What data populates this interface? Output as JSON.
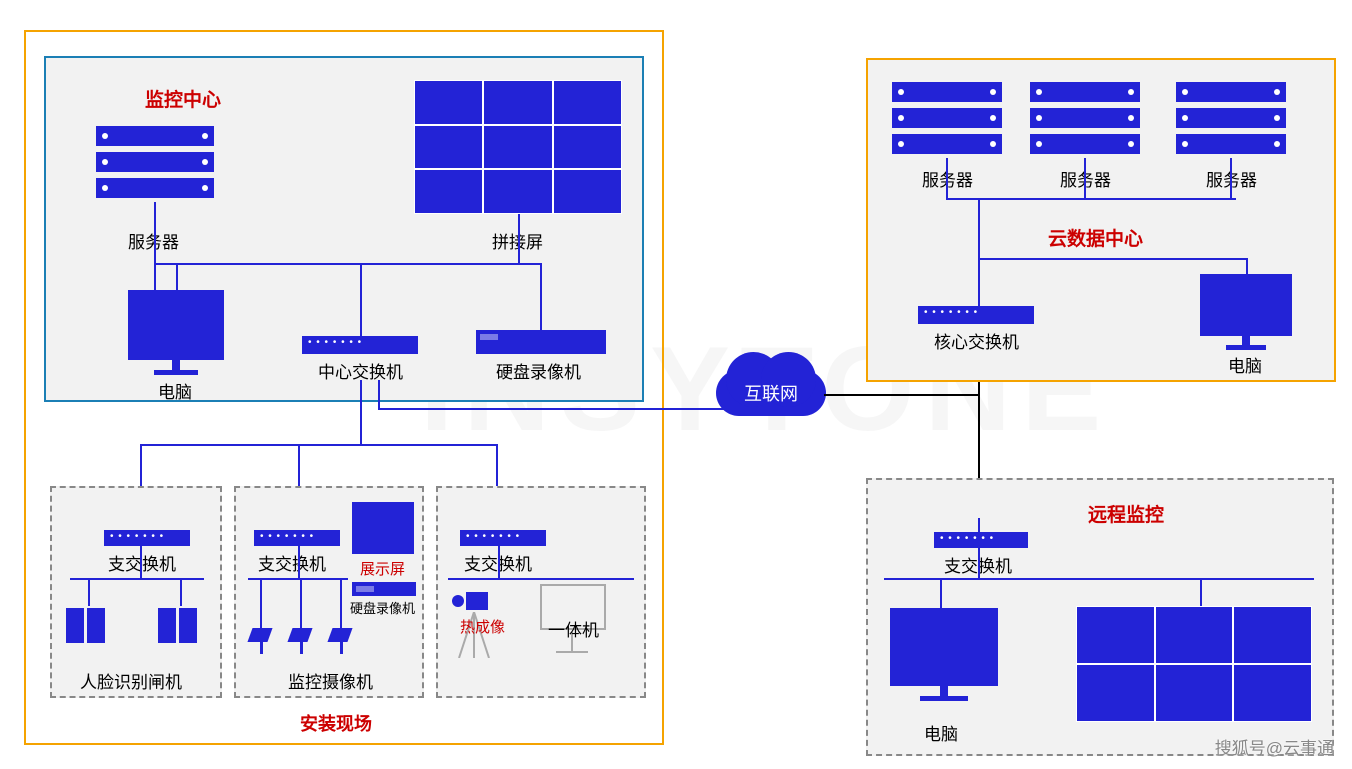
{
  "watermark": "搜狐号@云事通",
  "cloud": "互联网",
  "colors": {
    "primary": "#2323d6",
    "accentOrange": "#f5a300",
    "accentCyan": "#1b7fb5",
    "accentRed": "#cc0000"
  },
  "zones": {
    "installSite": {
      "title": "安装现场"
    },
    "monitorCenter": {
      "title": "监控中心",
      "server": "服务器",
      "videowall": "拼接屏",
      "pc": "电脑",
      "coreSwitch": "中心交换机",
      "nvr": "硬盘录像机"
    },
    "sub1": {
      "switch": "支交换机",
      "gate": "人脸识别闸机"
    },
    "sub2": {
      "switch": "支交换机",
      "display": "展示屏",
      "nvr": "硬盘录像机",
      "cams": "监控摄像机"
    },
    "sub3": {
      "switch": "支交换机",
      "thermal": "热成像",
      "kiosk": "一体机"
    },
    "cloudCenter": {
      "title": "云数据中心",
      "server1": "服务器",
      "server2": "服务器",
      "server3": "服务器",
      "coreSwitch": "核心交换机",
      "pc": "电脑"
    },
    "remote": {
      "title": "远程监控",
      "switch": "支交换机",
      "pc": "电脑"
    }
  }
}
